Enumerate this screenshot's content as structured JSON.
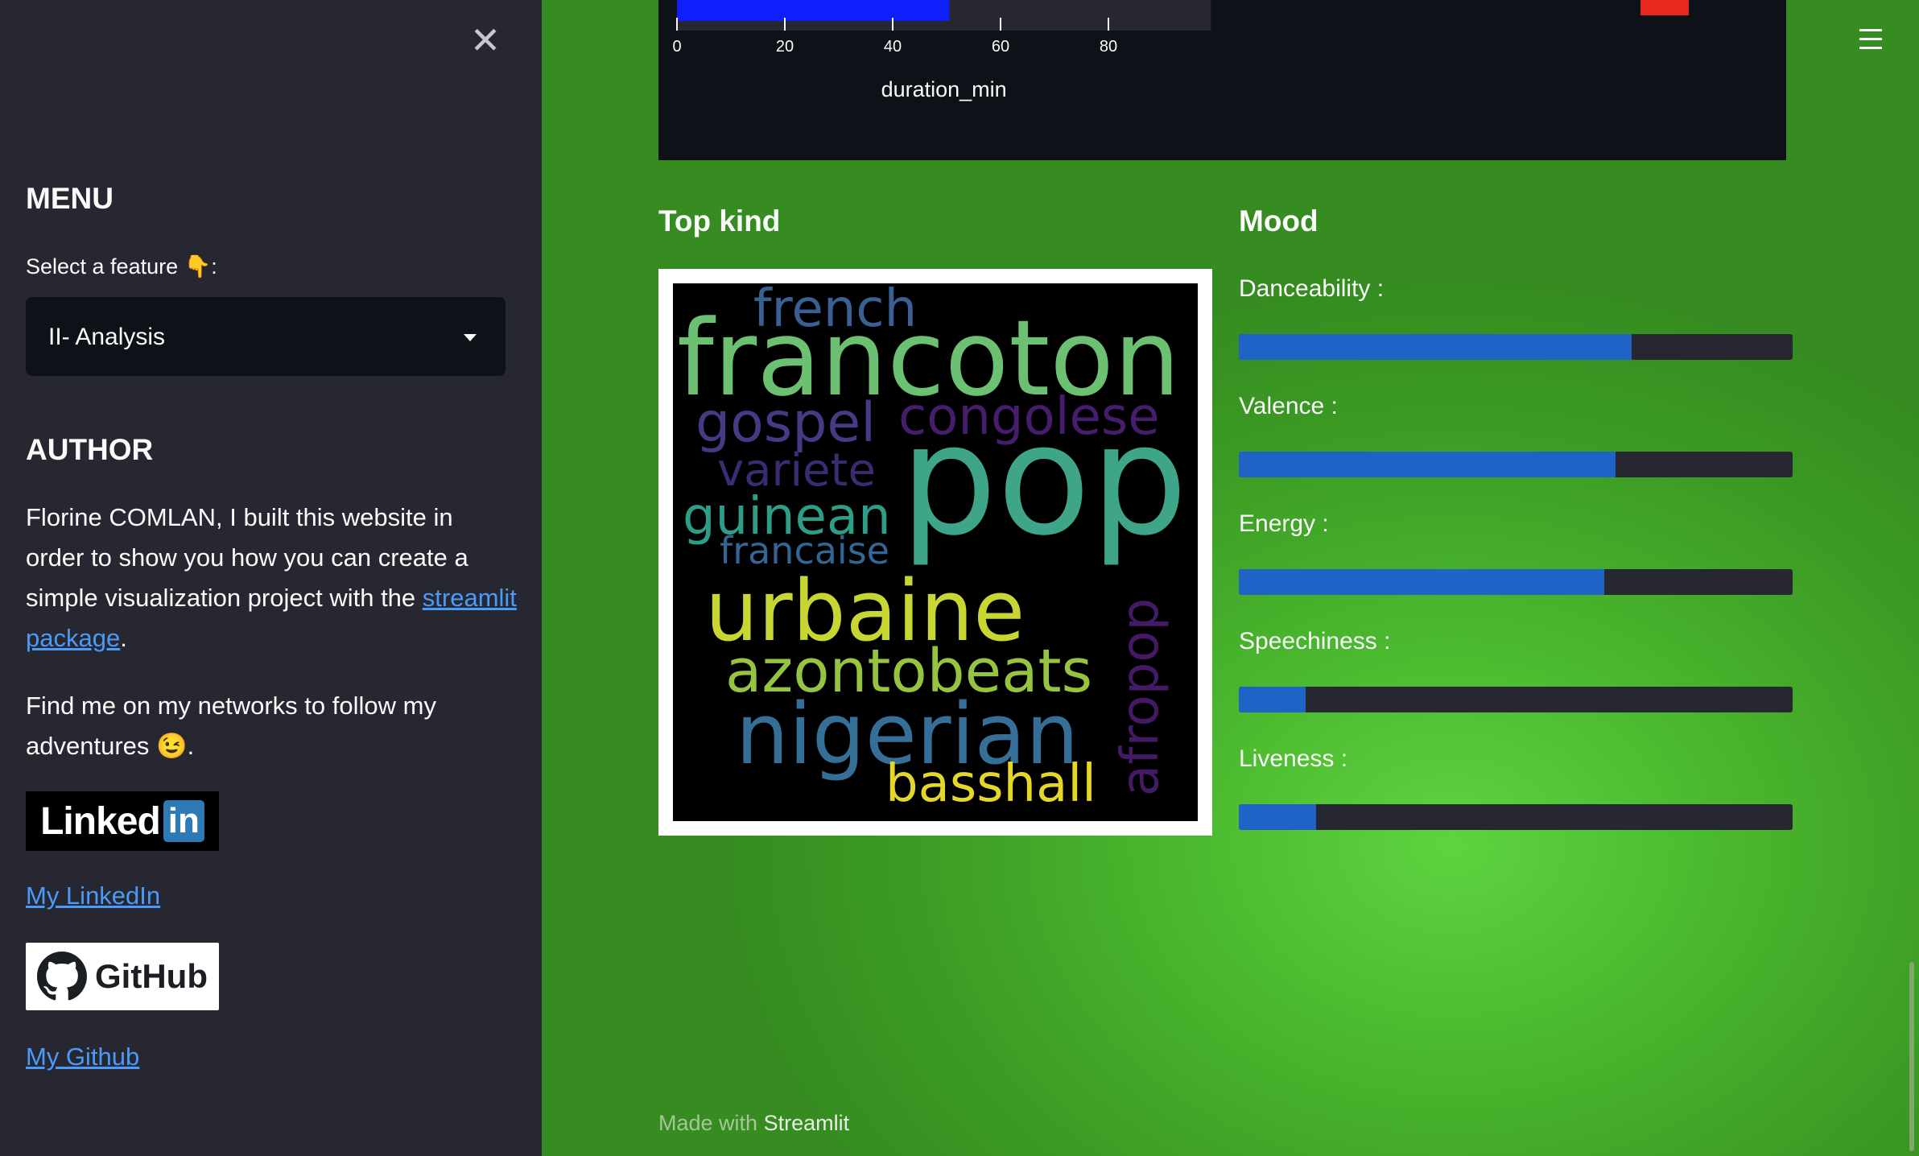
{
  "sidebar": {
    "close_glyph": "✕",
    "menu_title": "MENU",
    "select_label": "Select a feature 👇:",
    "select_value": "II- Analysis",
    "author_title": "AUTHOR",
    "author_text_before": "Florine COMLAN, I built this website in order to show you how you can create a simple visualization project with the ",
    "author_link": "streamlit package",
    "author_text_after": ".",
    "networks_text": "Find me on my networks to follow my adventures 😉.",
    "linkedin_badge": {
      "word": "Linked",
      "box": "in"
    },
    "linkedin_link": "My LinkedIn",
    "github_badge": {
      "word": "GitHub"
    },
    "github_link": "My Github"
  },
  "main": {
    "hamburger_icon": "menu-icon",
    "top_kind_title": "Top kind",
    "mood_title": "Mood",
    "footer_prefix": "Made with ",
    "footer_brand": "Streamlit"
  },
  "chart_data": {
    "type": "bar",
    "orientation": "horizontal",
    "xlabel": "duration_min",
    "x_ticks": [
      0,
      20,
      40,
      60,
      80
    ],
    "xlim": [
      0,
      99
    ],
    "bar_value": 50.5,
    "bar_color": "#0f1ffb",
    "legend_swatch_color": "#e8281e"
  },
  "wordcloud": {
    "words": [
      {
        "text": "french",
        "color": "#3a5f92"
      },
      {
        "text": "francoton",
        "color": "#6cc072"
      },
      {
        "text": "gospel",
        "color": "#433b84"
      },
      {
        "text": "congolese",
        "color": "#461d6c"
      },
      {
        "text": "variete",
        "color": "#3c2a72"
      },
      {
        "text": "pop",
        "color": "#3ea588"
      },
      {
        "text": "guinean",
        "color": "#2e9d88"
      },
      {
        "text": "francaise",
        "color": "#346693"
      },
      {
        "text": "urbaine",
        "color": "#c8d633"
      },
      {
        "text": "afropop",
        "color": "#441a64"
      },
      {
        "text": "azontobeats",
        "color": "#96c441"
      },
      {
        "text": "nigerian",
        "color": "#356e96"
      },
      {
        "text": "basshall",
        "color": "#e3d729"
      }
    ]
  },
  "mood": {
    "fill_color": "#1f63c6",
    "track_color": "#262730",
    "items": [
      {
        "label": "Danceability :",
        "value": 0.71
      },
      {
        "label": "Valence :",
        "value": 0.68
      },
      {
        "label": "Energy :",
        "value": 0.66
      },
      {
        "label": "Speechiness :",
        "value": 0.12
      },
      {
        "label": "Liveness :",
        "value": 0.14
      }
    ]
  }
}
